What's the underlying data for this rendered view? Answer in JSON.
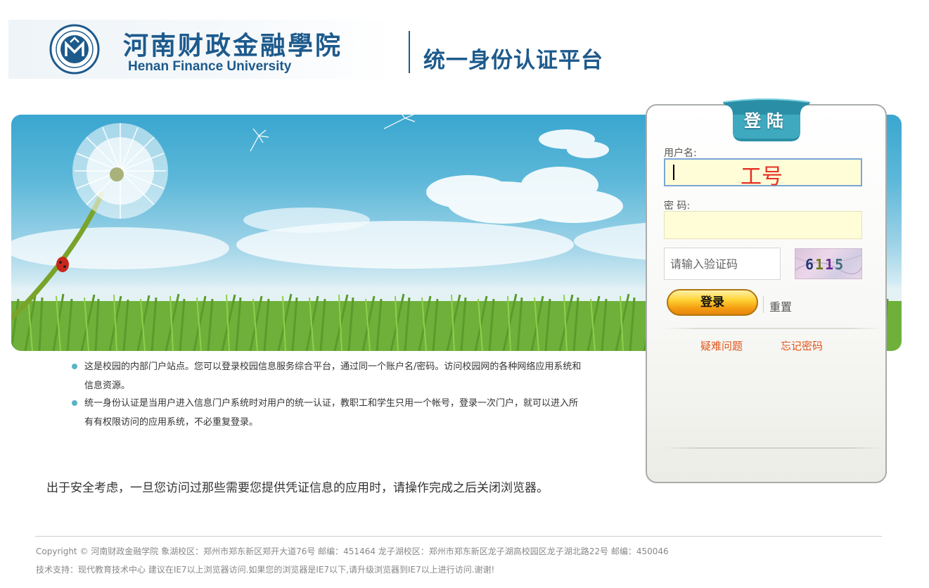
{
  "header": {
    "school_name_cn": "河南财政金融學院",
    "school_name_en": "Henan Finance University",
    "platform_title": "统一身份认证平台"
  },
  "login": {
    "tab_label": "登陆",
    "username_label": "用户名:",
    "username_hint": "工号",
    "password_label": "密 码:",
    "captcha_placeholder": "请输入验证码",
    "captcha_code": [
      "6",
      "1",
      "1",
      "5"
    ],
    "login_button": "登录",
    "reset_button": "重置",
    "help_link": "疑难问题",
    "forgot_link": "忘记密码"
  },
  "notices": [
    "这是校园的内部门户站点。您可以登录校园信息服务综合平台，通过同一个账户名/密码。访问校园网的各种网络应用系统和信息资源。",
    "统一身份认证是当用户进入信息门户系统时对用户的统一认证，教职工和学生只用一个帐号，登录一次门户，就可以进入所有有权限访问的应用系统，不必重复登录。"
  ],
  "security_note": "出于安全考虑，一旦您访问过那些需要您提供凭证信息的应用时，请操作完成之后关闭浏览器。",
  "footer": {
    "copyright": "Copyright © 河南财政金融学院 象湖校区：郑州市郑东新区郑开大道76号 邮编：451464 龙子湖校区：郑州市郑东新区龙子湖高校园区龙子湖北路22号 邮编：450046",
    "tech_support": "技术支持：现代教育技术中心 建议在IE7以上浏览器访问.如果您的浏览器是IE7以下,请升级浏览器到IE7以上进行访问.谢谢!"
  },
  "colors": {
    "brand_blue": "#1d5a8c",
    "accent_orange": "#e2541a",
    "username_hint": "#e53024",
    "input_fill": "#fffdd8",
    "bullet": "#5ab4c4"
  }
}
